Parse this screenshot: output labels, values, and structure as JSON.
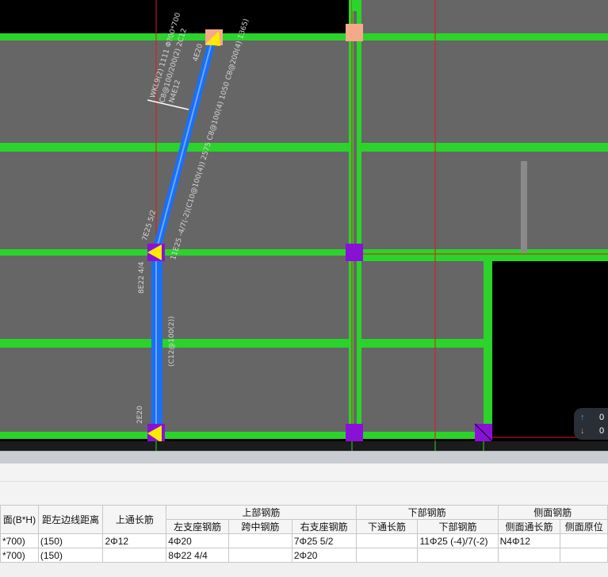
{
  "canvas": {
    "labels": {
      "beam_span": "WKL9(2) 1111 Φ?00*700",
      "beam_stirrup": "C8@100/200(2) 2C12",
      "beam_side": "N4E12",
      "top_left": "4E20",
      "top_right": "11E25 -4/7(-2)(C10@100(4)) 2575 C8@100(4) 1050 C8@200(4) 1365)",
      "mid_lower": "7E25 5/2",
      "col_side": "8E22 4/4",
      "col_stirrup": "(C12@100(2))",
      "col_bottom": "2E20"
    },
    "nav": {
      "up_value": "0",
      "down_value": "0"
    }
  },
  "table": {
    "header_row1": {
      "section": "面(B*H)",
      "left_distance": "距左边线距离",
      "top_through": "上通长筋",
      "top_group": "上部钢筋",
      "bottom_group": "下部钢筋",
      "side_group": "侧面钢筋"
    },
    "header_row2": {
      "left_support": "左支座钢筋",
      "mid_span": "跨中钢筋",
      "right_support": "右支座钢筋",
      "bottom_through": "下通长筋",
      "bottom_rebar": "下部钢筋",
      "side_through": "侧面通长筋",
      "side_original": "侧面原位"
    },
    "rows": [
      [
        "*700)",
        "(150)",
        "2Φ12",
        "4Φ20",
        "",
        "7Φ25 5/2",
        "",
        "11Φ25 (-4)/7(-2)",
        "N4Φ12",
        ""
      ],
      [
        "*700)",
        "(150)",
        "",
        "8Φ22 4/4",
        "",
        "2Φ20",
        "",
        "",
        "",
        ""
      ]
    ]
  }
}
